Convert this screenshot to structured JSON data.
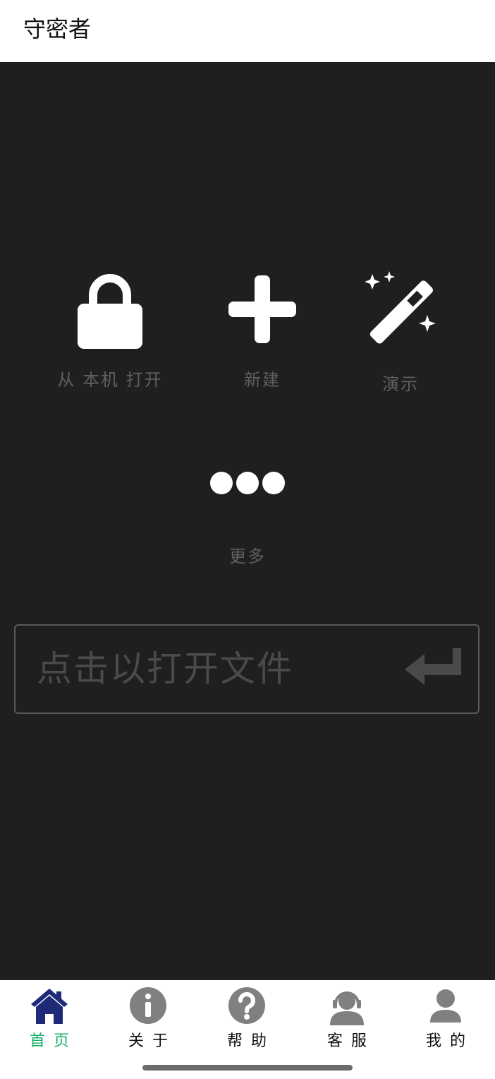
{
  "app": {
    "title": "守密者"
  },
  "actions": {
    "open_local": "从 本机 打开",
    "new": "新建",
    "demo": "演示",
    "more": "更多"
  },
  "open_prompt": "点击以打开文件",
  "tabs": [
    {
      "label": "首页",
      "icon": "home-icon",
      "active": true
    },
    {
      "label": "关于",
      "icon": "info-icon",
      "active": false
    },
    {
      "label": "帮助",
      "icon": "help-icon",
      "active": false
    },
    {
      "label": "客服",
      "icon": "support-icon",
      "active": false
    },
    {
      "label": "我的",
      "icon": "user-icon",
      "active": false
    }
  ],
  "colors": {
    "background": "#1f1f1f",
    "active_tab": "#18b36b",
    "home_icon": "#1e2a78",
    "muted_label": "#5f5f5f"
  }
}
